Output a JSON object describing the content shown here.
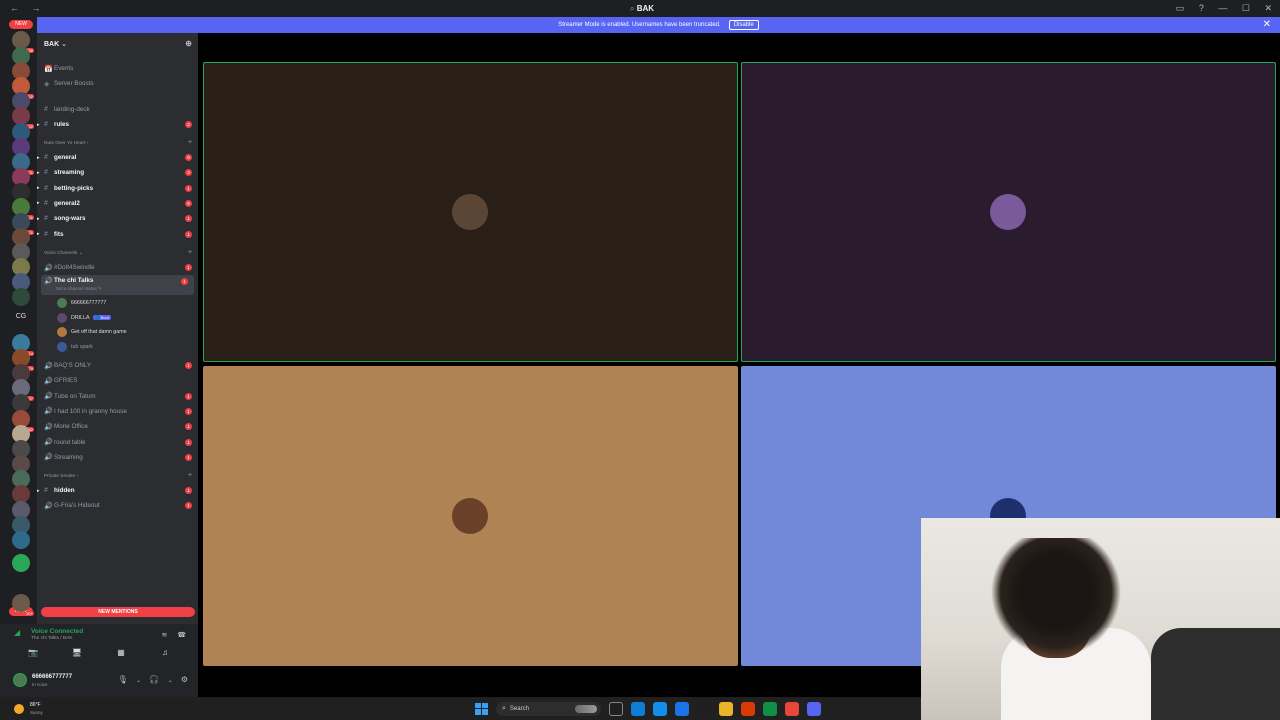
{
  "window": {
    "title": "BAK",
    "nav_back": "←",
    "nav_forward": "→",
    "ctrl_inbox": "▭",
    "ctrl_help": "?",
    "ctrl_min": "—",
    "ctrl_max": "☐",
    "ctrl_close": "✕"
  },
  "notice": {
    "text": "Streamer Mode is enabled. Usernames have been truncated.",
    "button": "Disable",
    "close": "✕"
  },
  "guilds": {
    "new_top": "NEW",
    "new_bottom": "NEW",
    "cg_label": "CG",
    "badges": [
      "736",
      "",
      "",
      "1552",
      "",
      "122",
      "",
      "",
      "2001",
      "",
      "",
      "641",
      "1821",
      "",
      "",
      "",
      "",
      "",
      "514",
      "279",
      "",
      "1557",
      "",
      "4682",
      "",
      "",
      "",
      "",
      "",
      "",
      "",
      "",
      "",
      "20+"
    ]
  },
  "server": {
    "name": "BAK",
    "chevron": "⌄",
    "add_icon": "⊕"
  },
  "channels": {
    "top": [
      {
        "label": "Events",
        "icon": "📅"
      },
      {
        "label": "Server Boosts",
        "icon": "◈"
      },
      {
        "label": "landing-deck",
        "icon": "#"
      },
      {
        "label": "rules",
        "icon": "#",
        "count": "2"
      }
    ],
    "cat1": "Nuts Over Yo Heart",
    "cat1_chev": "›",
    "text_list": [
      {
        "label": "general",
        "count": "9"
      },
      {
        "label": "streaming",
        "count": "3"
      },
      {
        "label": "betting-picks",
        "count": "1"
      },
      {
        "label": "general2",
        "count": "8"
      },
      {
        "label": "song-wars",
        "count": "1"
      },
      {
        "label": "fits",
        "count": "1"
      }
    ],
    "cat2": "Voice Channels",
    "cat2_chev": "⌄",
    "voice_top": {
      "label": "#DoIt4Swindle",
      "count": "1"
    },
    "selected": {
      "label": "The chi Talks",
      "sub": "Set a channel status ✎",
      "count": "1"
    },
    "voice_users": [
      {
        "name": "666666777777",
        "color": "#4e7a52"
      },
      {
        "name": "DRILLA",
        "bot": "🔵 Boot",
        "color": "#5c4a6a"
      },
      {
        "name": "Get off that damn game",
        "color": "#b07a40"
      },
      {
        "name": "tub spark",
        "color": "#3b5a9a"
      }
    ],
    "voice_list": [
      {
        "label": "BAQ'S ONLY",
        "count": "1"
      },
      {
        "label": "GFRIES",
        "count": ""
      },
      {
        "label": "Tube on Tatum",
        "count": "1"
      },
      {
        "label": "I had 100 in granny house",
        "count": "1"
      },
      {
        "label": "Mone Office",
        "count": "1"
      },
      {
        "label": "round table",
        "count": "1"
      },
      {
        "label": "Streaming",
        "count": "1"
      }
    ],
    "cat3": "Private Smoke",
    "cat3_chev": "›",
    "private_list": [
      {
        "label": "hidden",
        "icon": "#",
        "count": "1"
      },
      {
        "label": "G-Fria's Hideout",
        "icon": "🔊",
        "count": "1"
      }
    ],
    "plus": "+",
    "new_mentions": "NEW MENTIONS"
  },
  "voice_panel": {
    "status": "Voice Connected",
    "sub": "The chi Talks / BAK",
    "icon_signal": "≋",
    "icon_disconnect": "☎",
    "btn_camera": "📷",
    "btn_screen": "🖥",
    "btn_activity": "▦",
    "btn_soundboard": "♫"
  },
  "user": {
    "name": "666666777777",
    "status": "In voice",
    "mic": "🎙",
    "headset": "🎧",
    "settings": "⚙",
    "chev": "⌄"
  },
  "tiles": [
    {
      "bg": "#2a1f17",
      "speaking": true,
      "avatar": "#5b4636"
    },
    {
      "bg": "#2a1b2f",
      "speaking": true,
      "avatar": "#7a5a9a"
    },
    {
      "bg": "#b08355",
      "speaking": false,
      "avatar": "#6a4028"
    },
    {
      "bg": "#7289da",
      "speaking": false,
      "avatar": "#1d2f6e"
    }
  ],
  "taskbar": {
    "temp": "86°F",
    "weather": "Sunny",
    "search_icon": "⌕",
    "search_label": "Search",
    "app_colors": [
      "#1f1f1f",
      "#0f7dd8",
      "#118ee8",
      "#1a73e8",
      "#1f1f1f",
      "#e8b52a",
      "#d83b01",
      "#0d8f47",
      "#e8463b",
      "#5865f2"
    ]
  }
}
